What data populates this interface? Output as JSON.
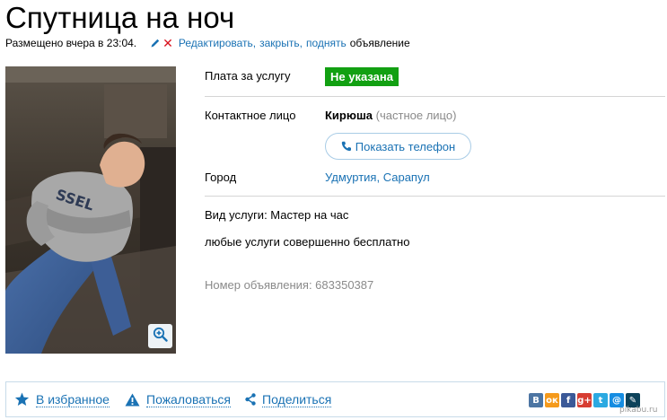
{
  "page": {
    "title": "Спутница на ноч"
  },
  "meta": {
    "posted": "Размещено вчера в 23:04.",
    "edit_link": "Редактировать",
    "close_link": "закрыть",
    "raise_link": "поднять",
    "tail_text": "объявление"
  },
  "details": {
    "fee_label": "Плата за услугу",
    "fee_value": "Не указана",
    "contact_label": "Контактное лицо",
    "contact_name": "Кирюша",
    "contact_type": "(частное лицо)",
    "phone_button": "Показать телефон",
    "city_label": "Город",
    "region": "Удмуртия",
    "city": "Сарапул",
    "service_type": "Вид услуги: Мастер на час",
    "description": "любые услуги совершенно бесплатно",
    "ad_number": "Номер объявления: 683350387"
  },
  "bottom": {
    "favorite": "В избранное",
    "complain": "Пожаловаться",
    "share": "Поделиться"
  },
  "social": [
    {
      "name": "vkontakte",
      "letter": "В",
      "color": "#4c75a3"
    },
    {
      "name": "odnoklassniki",
      "letter": "ок",
      "color": "#f59a1b"
    },
    {
      "name": "facebook",
      "letter": "f",
      "color": "#3b5998"
    },
    {
      "name": "google-plus",
      "letter": "g+",
      "color": "#d73d32"
    },
    {
      "name": "twitter",
      "letter": "t",
      "color": "#2ba9e1"
    },
    {
      "name": "mail-ru",
      "letter": "@",
      "color": "#168de2"
    },
    {
      "name": "livejournal",
      "letter": "✎",
      "color": "#0d425a"
    }
  ],
  "watermark": "pikabu.ru",
  "colors": {
    "link": "#1a72b4",
    "badge": "#12a012",
    "danger": "#d9121d"
  }
}
